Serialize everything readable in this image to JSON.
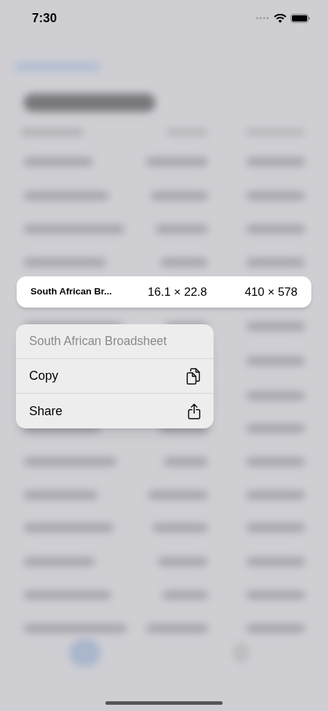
{
  "status_bar": {
    "time": "7:30"
  },
  "preview_row": {
    "name": "South African Br...",
    "size_cm": "16.1 × 22.8",
    "size_px": "410 × 578"
  },
  "menu": {
    "title": "South African Broadsheet",
    "items": [
      {
        "label": "Copy",
        "kind": "copy"
      },
      {
        "label": "Share",
        "kind": "share"
      }
    ]
  }
}
